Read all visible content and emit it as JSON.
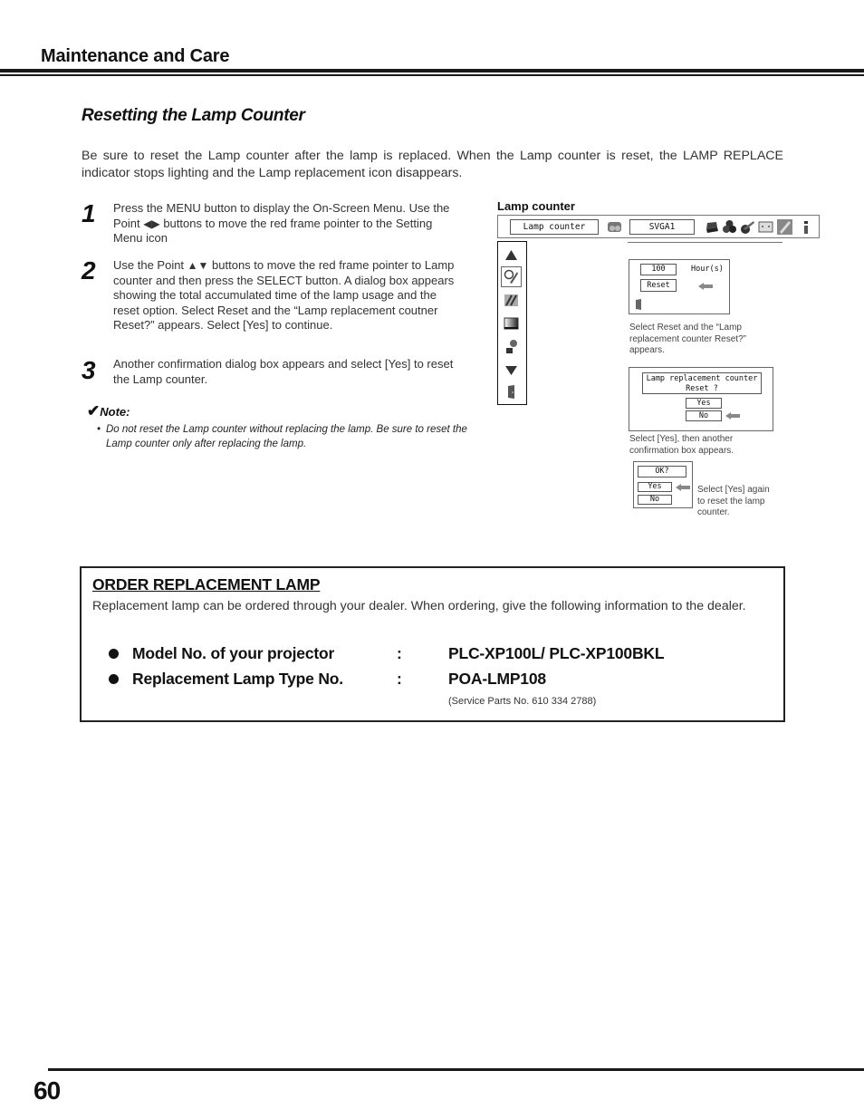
{
  "header": {
    "section_title": "Maintenance and Care"
  },
  "subtitle": "Resetting the Lamp Counter",
  "intro": "Be sure to reset the Lamp counter after the lamp is replaced. When the Lamp counter is reset, the LAMP REPLACE indicator stops lighting and the Lamp replacement icon disappears.",
  "steps": [
    {
      "number": "1",
      "text_before": "Press the MENU button to display the On-Screen Menu. Use the Point ",
      "glyph": "◀▶",
      "text_after": " buttons to move the red frame pointer to the Setting Menu icon"
    },
    {
      "number": "2",
      "text_before": "Use the Point ",
      "glyph": "▲▼",
      "text_after": " buttons to move the red frame pointer to Lamp counter and then press the SELECT button. A dialog box appears showing the total accumulated time of the lamp usage and the reset option. Select Reset and the “Lamp replacement coutner Reset?” appears. Select [Yes] to continue."
    },
    {
      "number": "3",
      "text_before": "Another confirmation dialog box appears and select [Yes] to reset the Lamp counter.",
      "glyph": "",
      "text_after": ""
    }
  ],
  "note": {
    "check": "✔",
    "heading": "Note:",
    "bullet": "•",
    "text": "Do not reset the Lamp counter without replacing the lamp. Be sure to reset the Lamp counter only after replacing the lamp."
  },
  "osd": {
    "label": "Lamp counter",
    "menu_item": "Lamp counter",
    "source": "SVGA1",
    "toolbar_icons": [
      "source-select-icon",
      "pc-adjust-icon",
      "color-adjust-icon",
      "image-adjust-icon",
      "screen-icon",
      "setting-icon",
      "information-icon"
    ],
    "side_icons": [
      "scroll-up-icon",
      "lamp-setting-icon",
      "tools-icon",
      "gradient-icon",
      "key-icon",
      "scroll-down-icon",
      "exit-door-icon"
    ],
    "dialog1": {
      "hours_value": "100",
      "hours_unit": "Hour(s)",
      "reset_button": "Reset",
      "caption": "Select Reset and the “Lamp replacement counter Reset?” appears."
    },
    "dialog2": {
      "question_line1": "Lamp replacement counter",
      "question_line2": "Reset ?",
      "yes": "Yes",
      "no": "No",
      "caption": "Select [Yes],  then another confirmation box appears."
    },
    "dialog3": {
      "question": "OK?",
      "yes": "Yes",
      "no": "No",
      "caption": "Select [Yes] again to reset the lamp counter."
    }
  },
  "order": {
    "title": "ORDER REPLACEMENT LAMP",
    "text": "Replacement lamp can be ordered through your dealer. When ordering, give the following information to the dealer.",
    "specs": [
      {
        "label": "Model No. of your projector",
        "separator": ":",
        "value": "PLC-XP100L/ PLC-XP100BKL"
      },
      {
        "label": "Replacement Lamp Type No.",
        "separator": ":",
        "value": "POA-LMP108"
      }
    ],
    "service_parts": "(Service Parts No. 610 334 2788)"
  },
  "footer": {
    "page_number": "60"
  }
}
